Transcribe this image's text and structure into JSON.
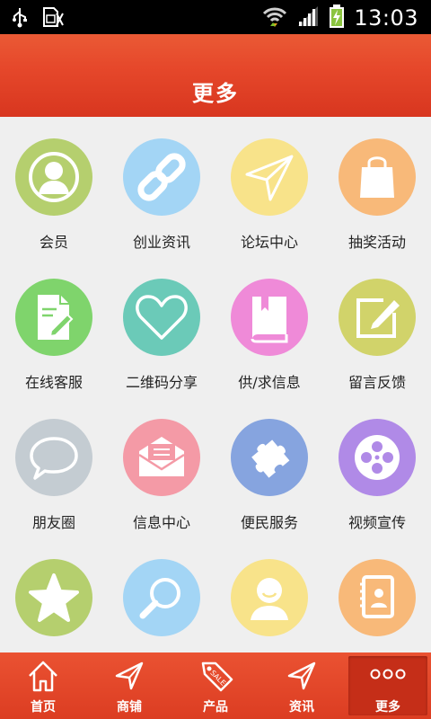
{
  "status_bar": {
    "time": "13:03",
    "icons": [
      "usb-icon",
      "sim-icon",
      "wifi-icon",
      "signal-icon",
      "battery-charging-icon"
    ]
  },
  "header": {
    "title": "更多"
  },
  "grid": {
    "items": [
      {
        "label": "会员",
        "icon": "member-icon",
        "color": "#b5cf6e"
      },
      {
        "label": "创业资讯",
        "icon": "link-icon",
        "color": "#a3d5f5"
      },
      {
        "label": "论坛中心",
        "icon": "paper-plane-icon",
        "color": "#f8e38a"
      },
      {
        "label": "抽奖活动",
        "icon": "shopping-bag-icon",
        "color": "#f8b979"
      },
      {
        "label": "在线客服",
        "icon": "document-edit-icon",
        "color": "#7fd46c"
      },
      {
        "label": "二维码分享",
        "icon": "heart-icon",
        "color": "#6bcab8"
      },
      {
        "label": "供/求信息",
        "icon": "book-icon",
        "color": "#ef8ad8"
      },
      {
        "label": "留言反馈",
        "icon": "note-edit-icon",
        "color": "#d1d36a"
      },
      {
        "label": "朋友圈",
        "icon": "speech-bubble-icon",
        "color": "#c4ccd2"
      },
      {
        "label": "信息中心",
        "icon": "envelope-icon",
        "color": "#f49aa6"
      },
      {
        "label": "便民服务",
        "icon": "puzzle-icon",
        "color": "#86a4df"
      },
      {
        "label": "视频宣传",
        "icon": "film-reel-icon",
        "color": "#b08ae7"
      },
      {
        "label": "",
        "icon": "star-icon",
        "color": "#b5cf6e"
      },
      {
        "label": "",
        "icon": "magnifier-icon",
        "color": "#a3d5f5"
      },
      {
        "label": "",
        "icon": "smiley-user-icon",
        "color": "#f8e38a"
      },
      {
        "label": "",
        "icon": "contacts-book-icon",
        "color": "#f8b979"
      }
    ]
  },
  "bottom_nav": {
    "tabs": [
      {
        "label": "首页",
        "icon": "home-icon"
      },
      {
        "label": "商铺",
        "icon": "navigation-arrow-icon"
      },
      {
        "label": "产品",
        "icon": "sale-tag-icon"
      },
      {
        "label": "资讯",
        "icon": "navigation-arrow-icon"
      },
      {
        "label": "更多",
        "icon": "more-dots-icon"
      }
    ],
    "active_index": 4
  }
}
